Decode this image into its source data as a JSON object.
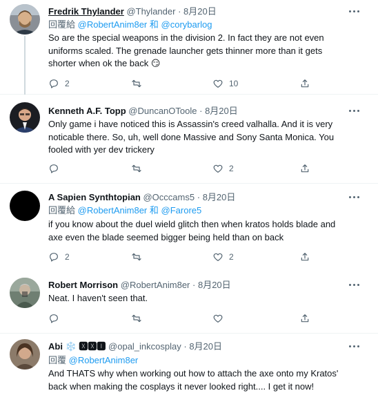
{
  "tweets": [
    {
      "name": "Fredrik Thylander",
      "handle": "@Thylander",
      "sep": "·",
      "date": "8月20日",
      "reply_prefix": "回覆給",
      "reply_to_1": "@RobertAnim8er",
      "reply_joiner": "和",
      "reply_to_2": "@corybarlog",
      "text": "So are the special weapons in the division 2. In fact they are not even uniforms scaled. The grenade launcher gets thinner more than it gets shorter when ok the back 😏",
      "reply_count": "2",
      "retweet_count": "",
      "like_count": "10"
    },
    {
      "name": "Kenneth A.F. Topp",
      "handle": "@DuncanOToole",
      "sep": "·",
      "date": "8月20日",
      "text": "Only game i have noticed this is Assassin's creed valhalla. And it is very noticable there. So, uh, well done Massive and Sony Santa Monica. You fooled with yer dev trickery",
      "reply_count": "",
      "retweet_count": "",
      "like_count": "2"
    },
    {
      "name": "A Sapien Synthtopian",
      "handle": "@Occcams5",
      "sep": "·",
      "date": "8月20日",
      "reply_prefix": "回覆給",
      "reply_to_1": "@RobertAnim8er",
      "reply_joiner": "和",
      "reply_to_2": "@Farore5",
      "text": "if you know about the duel wield glitch then when kratos holds blade and axe even the blade seemed bigger being held than on back",
      "reply_count": "2",
      "retweet_count": "",
      "like_count": "2"
    },
    {
      "name": "Robert Morrison",
      "handle": "@RobertAnim8er",
      "sep": "·",
      "date": "8月20日",
      "text": "Neat. I haven't seen that.",
      "reply_count": "",
      "retweet_count": "",
      "like_count": ""
    },
    {
      "name": "Abi",
      "name_glyph": "❄️",
      "name_suffix": "🆇🆇🅸",
      "handle": "@opal_inkcosplay",
      "sep": "·",
      "date": "8月20日",
      "reply_prefix": "回覆",
      "reply_to_1": "@RobertAnim8er",
      "text": "And THATS why when working out how to attach the axe onto my Kratos' back when making the cosplays it never looked right.... I get it now!"
    }
  ],
  "colors": {
    "link": "#1d9bf0",
    "muted": "#536471",
    "text": "#0f1419",
    "thread_line": "#cfd9de",
    "border": "#eff3f4"
  },
  "icons": [
    "reply-icon",
    "retweet-icon",
    "like-icon",
    "share-icon",
    "more-icon"
  ]
}
